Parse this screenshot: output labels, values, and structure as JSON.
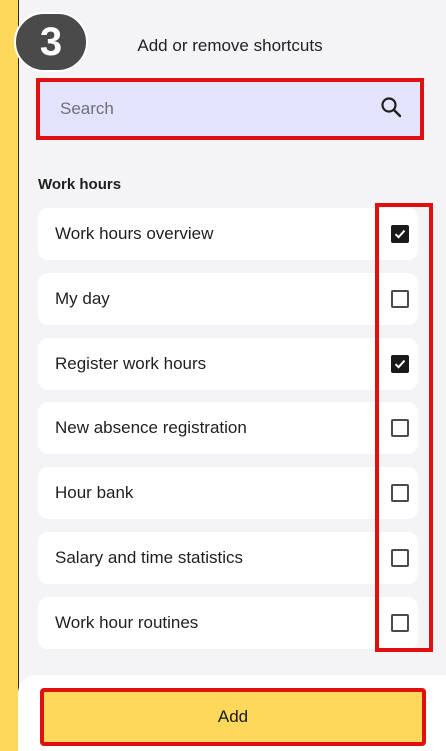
{
  "step_badge": "3",
  "header": {
    "title": "Add or remove shortcuts"
  },
  "search": {
    "placeholder": "Search",
    "value": "",
    "icon": "search-icon"
  },
  "section": {
    "title": "Work hours"
  },
  "items": [
    {
      "label": "Work hours overview",
      "checked": true
    },
    {
      "label": "My day",
      "checked": false
    },
    {
      "label": "Register work hours",
      "checked": true
    },
    {
      "label": "New absence registration",
      "checked": false
    },
    {
      "label": "Hour bank",
      "checked": false
    },
    {
      "label": "Salary and time statistics",
      "checked": false
    },
    {
      "label": "Work hour routines",
      "checked": false
    }
  ],
  "footer": {
    "add_label": "Add"
  },
  "colors": {
    "background": "#fdd85a",
    "panel": "#f4f4f6",
    "search_bg": "#e3e3fb",
    "highlight": "#e01010",
    "accent": "#fdd85a"
  }
}
